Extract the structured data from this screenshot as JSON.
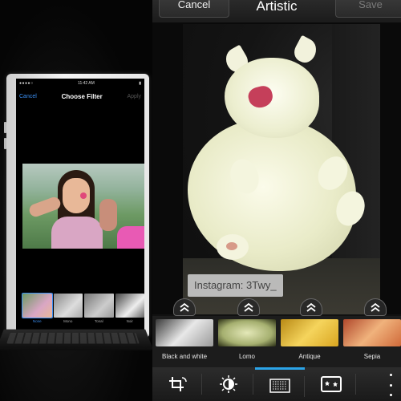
{
  "iphone": {
    "status_time": "11:42 AM",
    "nav": {
      "cancel": "Cancel",
      "title": "Choose Filter",
      "apply": "Apply"
    },
    "filters": [
      {
        "label": "None",
        "selected": true
      },
      {
        "label": "Mono",
        "selected": false
      },
      {
        "label": "Tonal",
        "selected": false
      },
      {
        "label": "Noir",
        "selected": false
      }
    ],
    "accent_color": "#3b8ff3"
  },
  "blackberry": {
    "header": {
      "cancel": "Cancel",
      "title": "Artistic",
      "save": "Save"
    },
    "caption": "Instagram: 3Twy_",
    "filters": [
      {
        "label": "Black and white"
      },
      {
        "label": "Lomo"
      },
      {
        "label": "Antique"
      },
      {
        "label": "Sepia"
      }
    ],
    "toolbar": {
      "actions": [
        {
          "icon": "crop-rotate-icon",
          "active": false
        },
        {
          "icon": "adjust-brightness-icon",
          "active": false
        },
        {
          "icon": "artistic-filter-icon",
          "active": true
        },
        {
          "icon": "frame-stars-icon",
          "active": false
        }
      ],
      "more_icon": "more-vertical-icon"
    },
    "accent_color": "#2ba4e8"
  }
}
